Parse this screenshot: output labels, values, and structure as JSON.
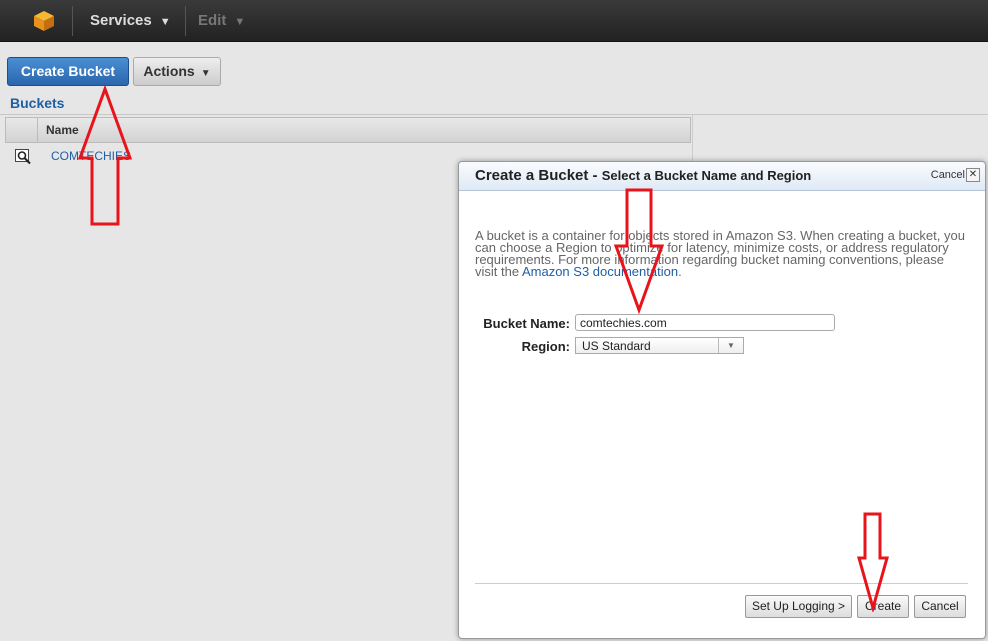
{
  "topbar": {
    "services_label": "Services",
    "edit_label": "Edit"
  },
  "toolbar": {
    "create_bucket_label": "Create Bucket",
    "actions_label": "Actions"
  },
  "buckets": {
    "title": "Buckets",
    "column_name": "Name",
    "rows": [
      {
        "name": "COMTECHIES"
      }
    ]
  },
  "dialog": {
    "title": "Create a Bucket",
    "title_sep": " - ",
    "subtitle": "Select a Bucket Name and Region",
    "cancel_link": "Cancel",
    "close_glyph": "✕",
    "description_1": "A bucket is a container for objects stored in Amazon S3. When creating a bucket, you can choose a Region to optimize for latency, minimize costs, or address regulatory requirements. For more information regarding bucket naming conventions, please visit the ",
    "description_link": "Amazon S3 documentation",
    "description_2": ".",
    "bucket_name_label": "Bucket Name:",
    "bucket_name_value": "comtechies.com",
    "region_label": "Region:",
    "region_value": "US Standard",
    "setup_logging_label": "Set Up Logging >",
    "create_label": "Create",
    "cancel_label": "Cancel"
  },
  "colors": {
    "accent_blue": "#2a66ad",
    "annotation_red": "#e8141c"
  }
}
